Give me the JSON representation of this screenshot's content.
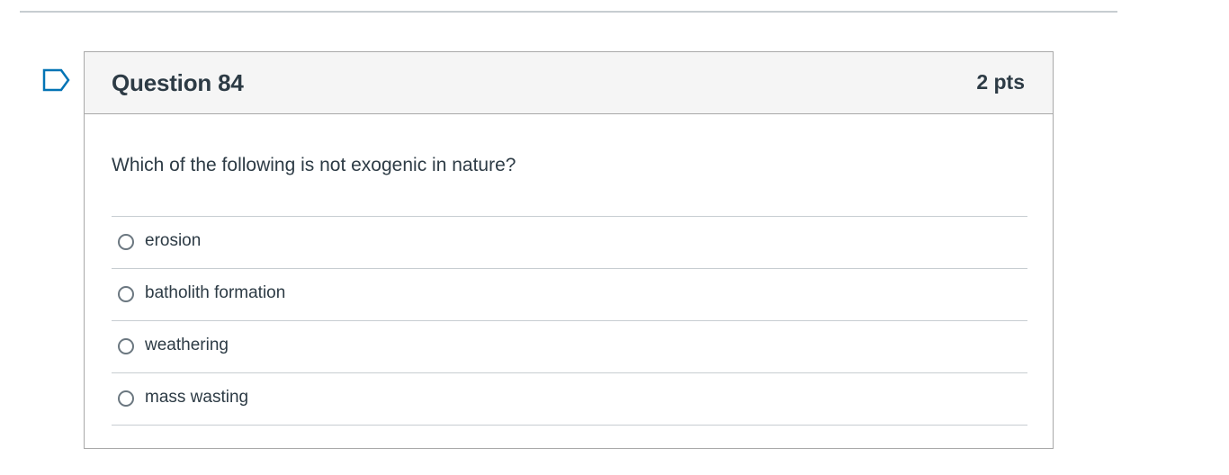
{
  "question": {
    "title": "Question 84",
    "points": "2 pts",
    "text": "Which of the following is not exogenic in nature?",
    "answers": [
      {
        "label": "erosion",
        "selected": false
      },
      {
        "label": "batholith formation",
        "selected": false
      },
      {
        "label": "weathering",
        "selected": false
      },
      {
        "label": "mass wasting",
        "selected": false
      }
    ]
  },
  "icons": {
    "flag": "flag-question-icon"
  },
  "colors": {
    "text": "#2d3b45",
    "flag": "#0374b5",
    "header_bg": "#f5f5f5",
    "border": "#a9a9a9",
    "divider": "#c7cdd1"
  }
}
